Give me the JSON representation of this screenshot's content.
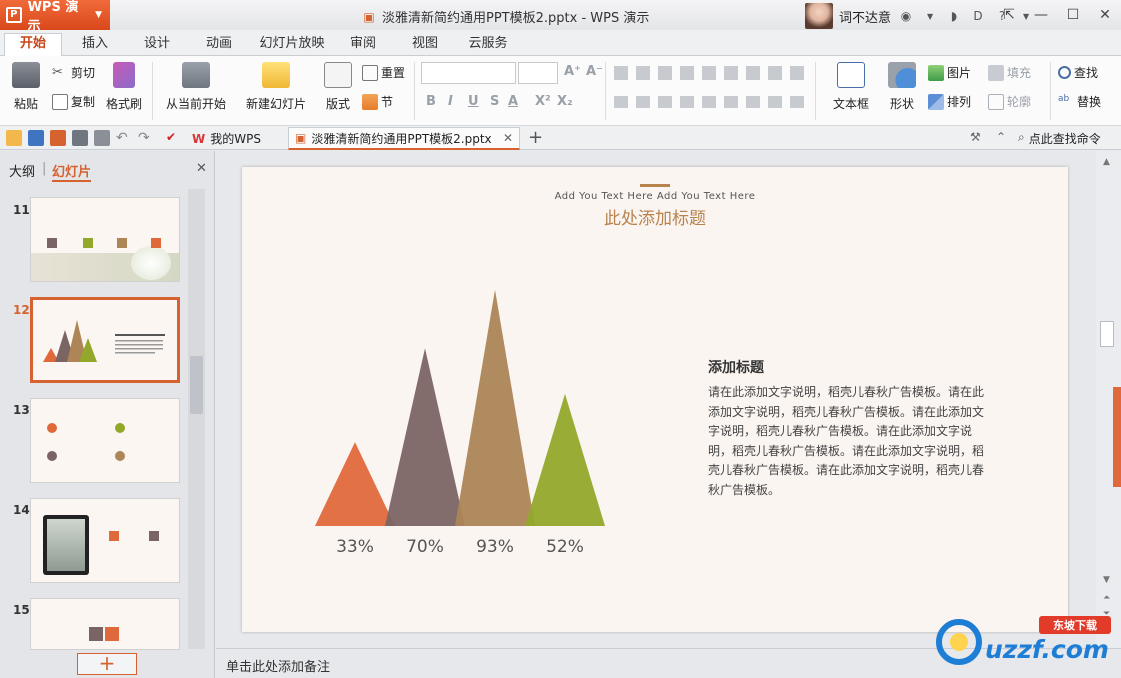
{
  "app": {
    "brand": "WPS 演示"
  },
  "window": {
    "title": "淡雅清新简约通用PPT模板2.pptx - WPS 演示",
    "user": "词不达意"
  },
  "menu_tabs": [
    "开始",
    "插入",
    "设计",
    "动画",
    "幻灯片放映",
    "审阅",
    "视图",
    "云服务"
  ],
  "ribbon": {
    "paste": "粘贴",
    "cut": "剪切",
    "copy": "复制",
    "format_painter": "格式刷",
    "from_current": "从当前开始",
    "new_slide": "新建幻灯片",
    "layout": "版式",
    "reset": "重置",
    "section": "节",
    "font_size_up": "A⁺",
    "font_size_down": "A⁻",
    "bold": "B",
    "italic": "I",
    "underline": "U",
    "strike": "S",
    "font_color": "A",
    "superscript": "X²",
    "subscript": "X₂",
    "textbox": "文本框",
    "shape": "形状",
    "picture": "图片",
    "fill": "填充",
    "arrange": "排列",
    "outline": "轮廓",
    "find": "查找",
    "replace": "替换"
  },
  "doc_tabs": {
    "home": "我的WPS",
    "current": "淡雅清新简约通用PPT模板2.pptx",
    "search": "点此查找命令"
  },
  "left_panel": {
    "tab_outline": "大纲",
    "tab_slides": "幻灯片",
    "slides": [
      {
        "num": "11"
      },
      {
        "num": "12"
      },
      {
        "num": "13"
      },
      {
        "num": "14"
      },
      {
        "num": "15"
      }
    ],
    "add_slide": "+"
  },
  "slide": {
    "subtitle": "Add You Text Here Add You Text Here",
    "title": "此处添加标题",
    "side_heading": "添加标题",
    "side_body": "请在此添加文字说明，稻壳儿春秋广告模板。请在此添加文字说明，稻壳儿春秋广告模板。请在此添加文字说明，稻壳儿春秋广告模板。请在此添加文字说明，稻壳儿春秋广告模板。请在此添加文字说明，稻壳儿春秋广告模板。请在此添加文字说明，稻壳儿春秋广告模板。"
  },
  "chart_data": {
    "type": "bar",
    "title": "",
    "xlabel": "",
    "ylabel": "",
    "categories": [
      "33%",
      "70%",
      "93%",
      "52%"
    ],
    "values": [
      33,
      70,
      93,
      52
    ],
    "ylim": [
      0,
      100
    ],
    "colors": [
      "#e0693c",
      "#7b6464",
      "#ad8557",
      "#93a82a"
    ],
    "grid": false,
    "legend": "none"
  },
  "notes": {
    "placeholder": "单击此处添加备注"
  },
  "watermark": {
    "text": "uzzf.com",
    "tag": "东坡下载"
  },
  "colors": {
    "accent": "#d5622f",
    "title": "#b8834d"
  }
}
